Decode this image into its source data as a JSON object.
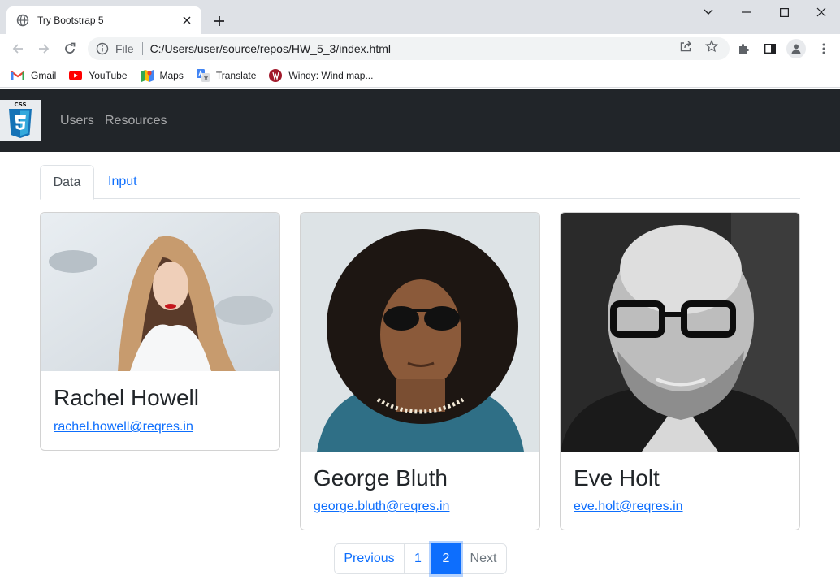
{
  "browser": {
    "tab_title": "Try Bootstrap 5",
    "file_label": "File",
    "url": "C:/Users/user/source/repos/HW_5_3/index.html",
    "bookmarks": [
      {
        "label": "Gmail",
        "icon": "gmail-icon"
      },
      {
        "label": "YouTube",
        "icon": "youtube-icon"
      },
      {
        "label": "Maps",
        "icon": "maps-icon"
      },
      {
        "label": "Translate",
        "icon": "translate-icon"
      },
      {
        "label": "Windy: Wind map...",
        "icon": "windy-icon"
      }
    ]
  },
  "navbar": {
    "brand_icon": "css3-logo",
    "links": [
      "Users",
      "Resources"
    ]
  },
  "tabs": [
    "Data",
    "Input"
  ],
  "cards": [
    {
      "name": "Rachel Howell",
      "email": "rachel.howell@reqres.in",
      "photo": "woman-in-hood-photo"
    },
    {
      "name": "George Bluth",
      "email": "george.bluth@reqres.in",
      "photo": "man-in-sunglasses-photo"
    },
    {
      "name": "Eve Holt",
      "email": "eve.holt@reqres.in",
      "photo": "bald-man-glasses-photo"
    }
  ],
  "pagination": {
    "previous": "Previous",
    "pages": [
      "1",
      "2"
    ],
    "active": "2",
    "next": "Next"
  },
  "colors": {
    "navbar_bg": "#212529",
    "primary": "#0d6efd"
  }
}
